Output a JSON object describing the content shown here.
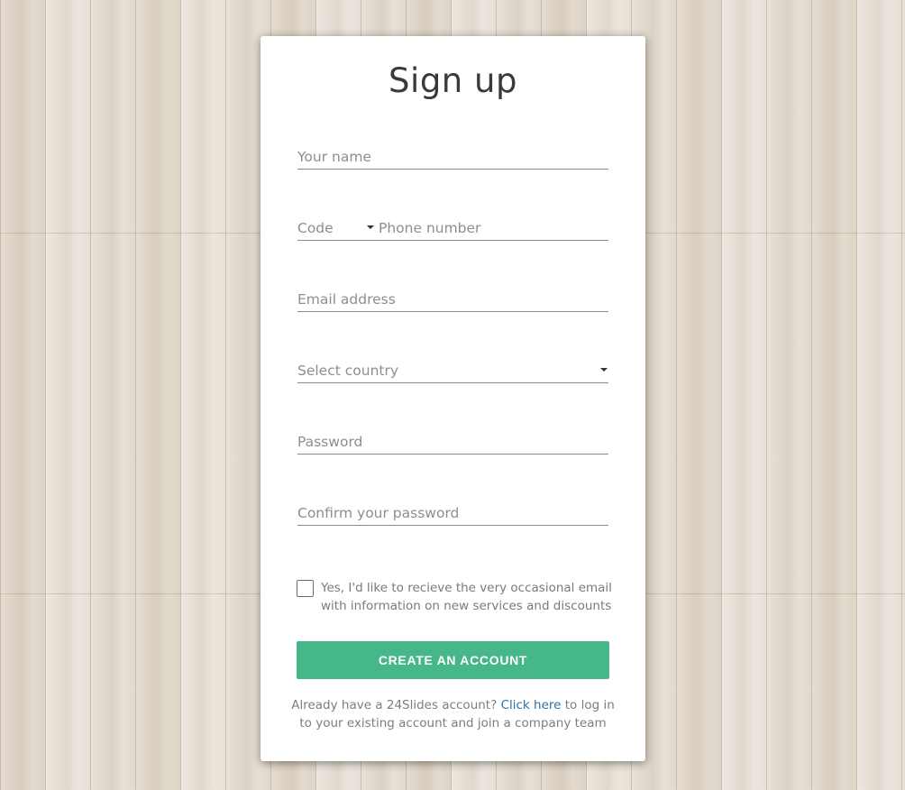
{
  "title": "Sign up",
  "fields": {
    "name_placeholder": "Your name",
    "code_placeholder": "Code",
    "phone_placeholder": "Phone number",
    "email_placeholder": "Email address",
    "country_placeholder": "Select country",
    "password_placeholder": "Password",
    "confirm_placeholder": "Confirm your password"
  },
  "newsletter": {
    "checked": false,
    "line1": "Yes, I'd like to recieve the very occasional email",
    "line2": "with information on new services and discounts"
  },
  "submit_label": "CREATE AN ACCOUNT",
  "footer": {
    "prefix": "Already have a 24Slides account?",
    "link": "Click here",
    "suffix": "to log in",
    "line2": "to your existing account and join a company team"
  },
  "colors": {
    "button_bg": "#45b789",
    "link": "#2f6fa8"
  },
  "icons": {
    "code_dropdown": "caret-down-icon",
    "country_dropdown": "caret-down-icon",
    "checkbox": "checkbox-unchecked-icon"
  }
}
